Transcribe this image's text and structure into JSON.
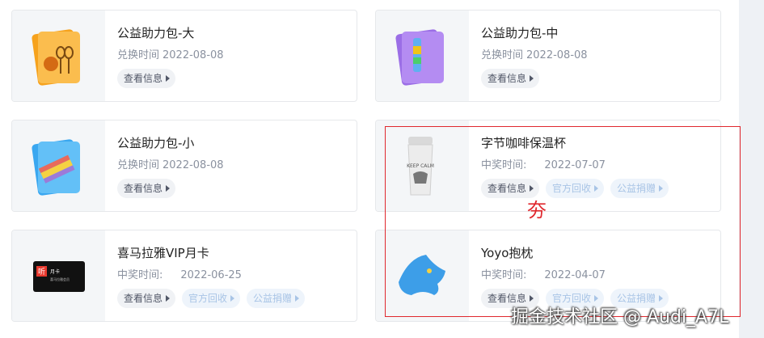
{
  "cards": [
    {
      "title": "公益助力包-大",
      "meta_label": "兑换时间",
      "meta_value": "2022-08-08",
      "buttons": [
        "查看信息"
      ]
    },
    {
      "title": "公益助力包-中",
      "meta_label": "兑换时间",
      "meta_value": "2022-08-08",
      "buttons": [
        "查看信息"
      ]
    },
    {
      "title": "公益助力包-小",
      "meta_label": "兑换时间",
      "meta_value": "2022-08-08",
      "buttons": [
        "查看信息"
      ]
    },
    {
      "title": "字节咖啡保温杯",
      "meta_label": "中奖时间:",
      "meta_value": "2022-07-07",
      "buttons": [
        "查看信息",
        "官方回收",
        "公益捐赠"
      ]
    },
    {
      "title": "喜马拉雅VIP月卡",
      "meta_label": "中奖时间:",
      "meta_value": "2022-06-25",
      "buttons": [
        "查看信息",
        "官方回收",
        "公益捐赠"
      ]
    },
    {
      "title": "Yoyo抱枕",
      "meta_label": "中奖时间:",
      "meta_value": "2022-04-07",
      "buttons": [
        "查看信息",
        "官方回收",
        "公益捐赠"
      ]
    }
  ],
  "card_thumb_text": {
    "mug_text": "KEEP CALM",
    "vip_card_icon": "听",
    "vip_card_title": "月卡",
    "vip_card_sub": "喜马拉雅会员"
  },
  "annotation": {
    "char": "夯"
  },
  "watermark": "掘金技术社区 @ Audi_A7L",
  "colors": {
    "accent_red": "#e0282e",
    "muted_btn_text": "#a8c4e6"
  }
}
